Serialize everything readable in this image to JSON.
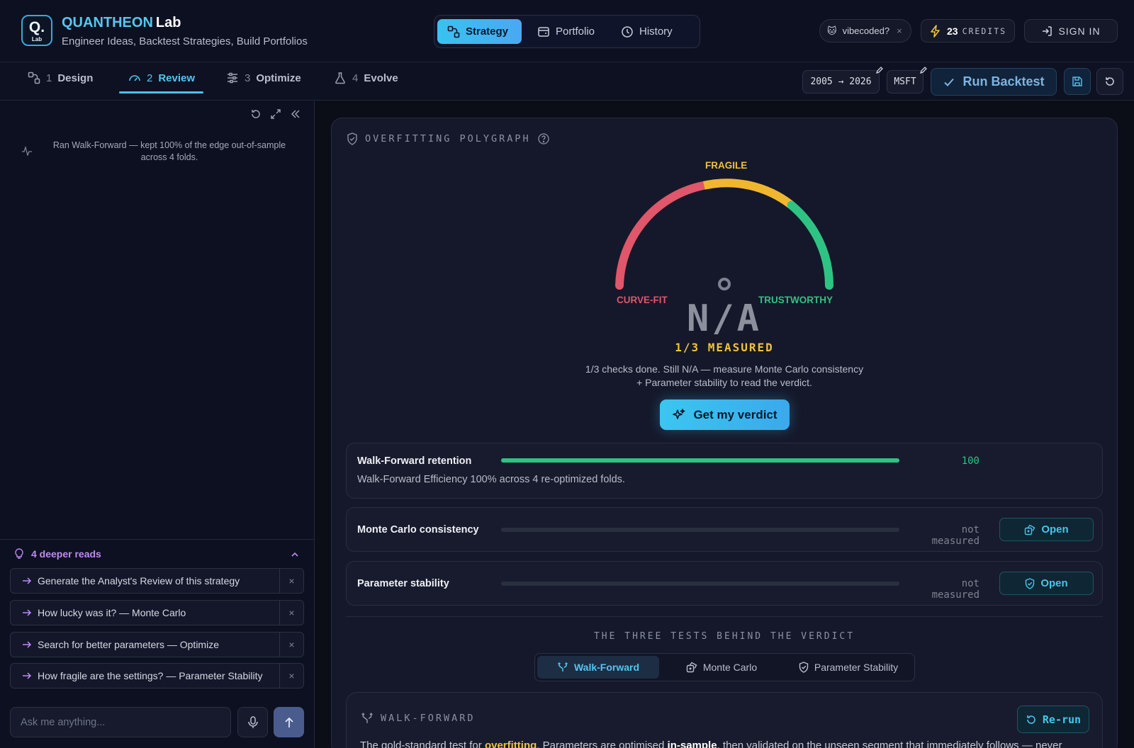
{
  "app": {
    "brand_main": "QUANTHEON",
    "brand_sub": "Lab",
    "logo_letter": "Q.",
    "logo_small": "Lab",
    "tagline": "Engineer Ideas, Backtest Strategies, Build Portfolios"
  },
  "nav": {
    "items": [
      {
        "label": "Strategy",
        "icon": "strategy-icon",
        "active": true
      },
      {
        "label": "Portfolio",
        "icon": "portfolio-icon",
        "active": false
      },
      {
        "label": "History",
        "icon": "history-icon",
        "active": false
      }
    ]
  },
  "account": {
    "badge_emoji": "🐱",
    "badge_label": "vibecoded?",
    "badge_close": "×",
    "credits_count": "23",
    "credits_label": "CREDITS",
    "sign_in": "SIGN IN"
  },
  "steps": [
    {
      "num": "1",
      "label": "Design",
      "icon": "design-icon"
    },
    {
      "num": "2",
      "label": "Review",
      "icon": "gauge-icon",
      "active": true
    },
    {
      "num": "3",
      "label": "Optimize",
      "icon": "sliders-icon"
    },
    {
      "num": "4",
      "label": "Evolve",
      "icon": "flask-icon"
    }
  ],
  "toolbar": {
    "date_range": "2005 → 2026",
    "ticker": "MSFT",
    "run_label": "Run Backtest"
  },
  "sidebar": {
    "log": "Ran Walk-Forward — kept 100% of the edge out-of-sample across 4 folds.",
    "deeper_title": "4 deeper reads",
    "suggestions": [
      "Generate the Analyst's Review of this strategy",
      "How lucky was it? — Monte Carlo",
      "Search for better parameters — Optimize",
      "How fragile are the settings? — Parameter Stability"
    ],
    "dismiss": "×",
    "ask_placeholder": "Ask me anything..."
  },
  "polygraph": {
    "title": "OVERFITTING POLYGRAPH",
    "gauge_top": "FRAGILE",
    "gauge_left": "CURVE-FIT",
    "gauge_right": "TRUSTWORTHY",
    "score": "N/A",
    "measured": "1/3 MEASURED",
    "note": "1/3 checks done. Still N/A — measure Monte Carlo consistency + Parameter stability to read the verdict.",
    "verdict_button": "Get my verdict",
    "colors": {
      "red": "#e0566a",
      "yellow": "#f0b72e",
      "green": "#2fc383",
      "accent": "#3bc6f0"
    }
  },
  "checks": [
    {
      "label": "Walk-Forward retention",
      "value": "100",
      "fill": 1.0,
      "detail": "Walk-Forward Efficiency 100% across 4 re-optimized folds."
    },
    {
      "label": "Monte Carlo consistency",
      "value": "not measured",
      "fill": 0,
      "action": "Open",
      "icon": "dice-icon"
    },
    {
      "label": "Parameter stability",
      "value": "not measured",
      "fill": 0,
      "action": "Open",
      "icon": "shield-check-icon"
    }
  ],
  "tests": {
    "heading": "THE THREE TESTS BEHIND THE VERDICT",
    "tabs": [
      {
        "label": "Walk-Forward",
        "icon": "fork-icon",
        "active": true
      },
      {
        "label": "Monte Carlo",
        "icon": "dice-icon",
        "active": false
      },
      {
        "label": "Parameter Stability",
        "icon": "shield-check-icon",
        "active": false
      }
    ]
  },
  "walkforward": {
    "title": "WALK-FORWARD",
    "rerun": "Re-run",
    "body_pre": "The gold-standard test for ",
    "body_hl": "overfitting",
    "body_mid": ". Parameters are optimised ",
    "body_bold": "in-sample",
    "body_post": ", then validated on the unseen segment that immediately follows — never"
  }
}
